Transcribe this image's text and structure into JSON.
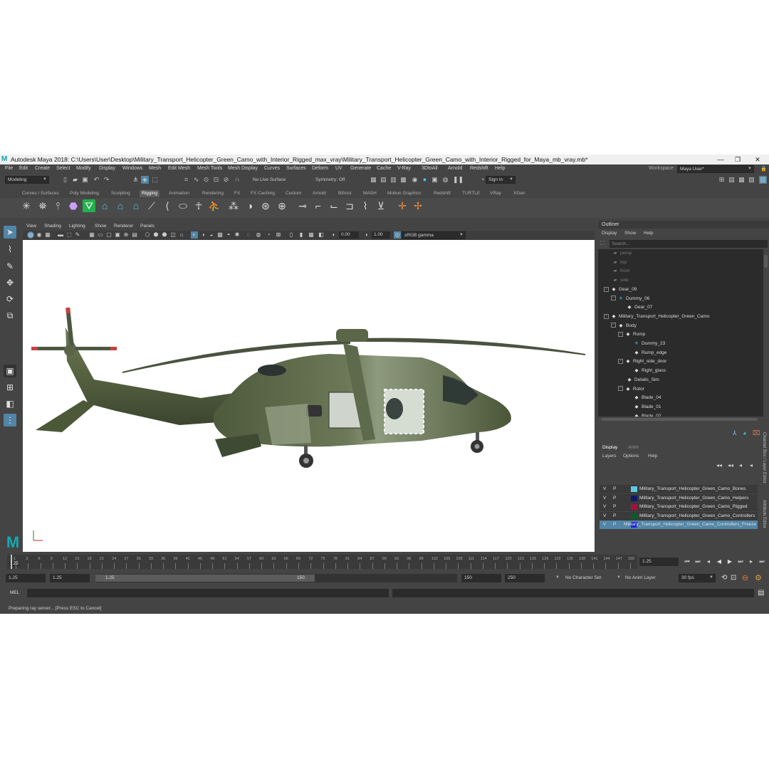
{
  "window": {
    "title": "Autodesk Maya 2018: C:\\Users\\User\\Desktop\\Military_Transport_Helicopter_Green_Camo_with_Interior_Rigged_max_vray\\Military_Transport_Helicopter_Green_Camo_with_Interior_Rigged_for_Maya_mb_vray.mb*",
    "minimize": "—",
    "maximize": "❐",
    "close": "✕"
  },
  "menu": [
    "File",
    "Edit",
    "Create",
    "Select",
    "Modify",
    "Display",
    "Windows",
    "Mesh",
    "Edit Mesh",
    "Mesh Tools",
    "Mesh Display",
    "Curves",
    "Surfaces",
    "Deform",
    "UV",
    "Generate",
    "Cache",
    "V-Ray",
    "3DtoAll",
    "Arnold",
    "Redshift",
    "Help"
  ],
  "workspace": {
    "label": "Workspace :",
    "value": "Maya User*"
  },
  "statusline": {
    "mode": "Modeling",
    "live_surface": "No Live Surface",
    "symmetry": "Symmetry: Off",
    "sign_in": "Sign In"
  },
  "shelf_tabs": [
    "Curves / Surfaces",
    "Poly Modeling",
    "Sculpting",
    "Rigging",
    "Animation",
    "Rendering",
    "FX",
    "FX Caching",
    "Custom",
    "Arnold",
    "Bifrost",
    "MASH",
    "Motion Graphics",
    "Redshift",
    "TURTLE",
    "VRay",
    "XGen"
  ],
  "active_shelf": "Rigging",
  "viewport_menu": [
    "View",
    "Shading",
    "Lighting",
    "Show",
    "Renderer",
    "Panels"
  ],
  "viewport_fields": {
    "exposure": "0.00",
    "gamma": "1.00",
    "colorspace": "sRGB gamma"
  },
  "outliner": {
    "title": "Outliner",
    "menu": [
      "Display",
      "Show",
      "Help"
    ],
    "search_placeholder": "Search...",
    "items": [
      {
        "label": "persp",
        "depth": 0,
        "icon": "camera-icon",
        "dim": true
      },
      {
        "label": "top",
        "depth": 0,
        "icon": "camera-icon",
        "dim": true
      },
      {
        "label": "front",
        "depth": 0,
        "icon": "camera-icon",
        "dim": true
      },
      {
        "label": "side",
        "depth": 0,
        "icon": "camera-icon",
        "dim": true
      },
      {
        "label": "Gear_09",
        "depth": 0,
        "icon": "transform-icon",
        "expand": true
      },
      {
        "label": "Dummy_06",
        "depth": 1,
        "icon": "dummy-icon",
        "expand": true
      },
      {
        "label": "Gear_07",
        "depth": 2,
        "icon": "transform-icon"
      },
      {
        "label": "Military_Transport_Helicopter_Green_Camo",
        "depth": 0,
        "icon": "transform-icon",
        "expand": true
      },
      {
        "label": "Body",
        "depth": 1,
        "icon": "transform-icon",
        "expand": true
      },
      {
        "label": "Rump",
        "depth": 2,
        "icon": "transform-icon",
        "expand": true
      },
      {
        "label": "Dummy_23",
        "depth": 3,
        "icon": "dummy-icon"
      },
      {
        "label": "Rump_edge",
        "depth": 3,
        "icon": "transform-icon"
      },
      {
        "label": "Right_side_door",
        "depth": 2,
        "icon": "transform-icon",
        "expand": true
      },
      {
        "label": "Right_glass",
        "depth": 3,
        "icon": "transform-icon"
      },
      {
        "label": "Details_Sim",
        "depth": 2,
        "icon": "transform-icon"
      },
      {
        "label": "Rotor",
        "depth": 2,
        "icon": "transform-icon",
        "expand": true
      },
      {
        "label": "Blade_04",
        "depth": 3,
        "icon": "transform-icon"
      },
      {
        "label": "Blade_01",
        "depth": 3,
        "icon": "transform-icon"
      },
      {
        "label": "Blade_02",
        "depth": 3,
        "icon": "transform-icon"
      }
    ]
  },
  "layer_editor": {
    "tabs": [
      "Display",
      "Anim"
    ],
    "menu": [
      "Layers",
      "Options",
      "Help"
    ],
    "layers": [
      {
        "v": "V",
        "p": "P",
        "color": "#5fc8e6",
        "name": "Military_Transport_Helicopter_Green_Camo_Bones"
      },
      {
        "v": "V",
        "p": "P",
        "color": "#101a6b",
        "name": "Military_Transport_Helicopter_Green_Camo_Helpers"
      },
      {
        "v": "V",
        "p": "P",
        "color": "#a3123a",
        "name": "Military_Transport_Helicopter_Green_Camo_Rigged"
      },
      {
        "v": "V",
        "p": "P",
        "color": "#0b5a2b",
        "name": "Military_Transport_Helicopter_Green_Camo_Controllers"
      },
      {
        "v": "V",
        "p": "P",
        "color": "#1b25d8",
        "name": "Military_Transport_Helicopter_Green_Camo_Controllers_Freeze",
        "selected": true
      }
    ],
    "side_tabs": [
      "Channel Box / Layer Editor",
      "Attribute Editor"
    ]
  },
  "timeline": {
    "ticks": [
      "1",
      "3",
      "6",
      "9",
      "12",
      "15",
      "18",
      "21",
      "24",
      "27",
      "30",
      "33",
      "36",
      "39",
      "42",
      "45",
      "48",
      "51",
      "54",
      "57",
      "60",
      "63",
      "66",
      "69",
      "72",
      "75",
      "78",
      "81",
      "84",
      "87",
      "90",
      "93",
      "96",
      "99",
      "102",
      "105",
      "108",
      "111",
      "114",
      "117",
      "120",
      "123",
      "126",
      "129",
      "132",
      "135",
      "138",
      "141",
      "144",
      "147",
      "150"
    ],
    "current_frame": "1.25",
    "current_field": "1.25"
  },
  "range": {
    "start": "1.25",
    "anim_start": "1.25",
    "slider_start": "1.25",
    "slider_end": "150",
    "end": "150",
    "anim_end": "250",
    "character_set": "No Character Set",
    "anim_layer": "No Anim Layer",
    "fps": "30 fps"
  },
  "command_line": {
    "label": "MEL"
  },
  "status_text": "Preparing ray server... [Press ESC to Cancel]",
  "colors": {
    "accent": "#5285a6",
    "panel": "#444444",
    "field": "#2b2b2b"
  }
}
